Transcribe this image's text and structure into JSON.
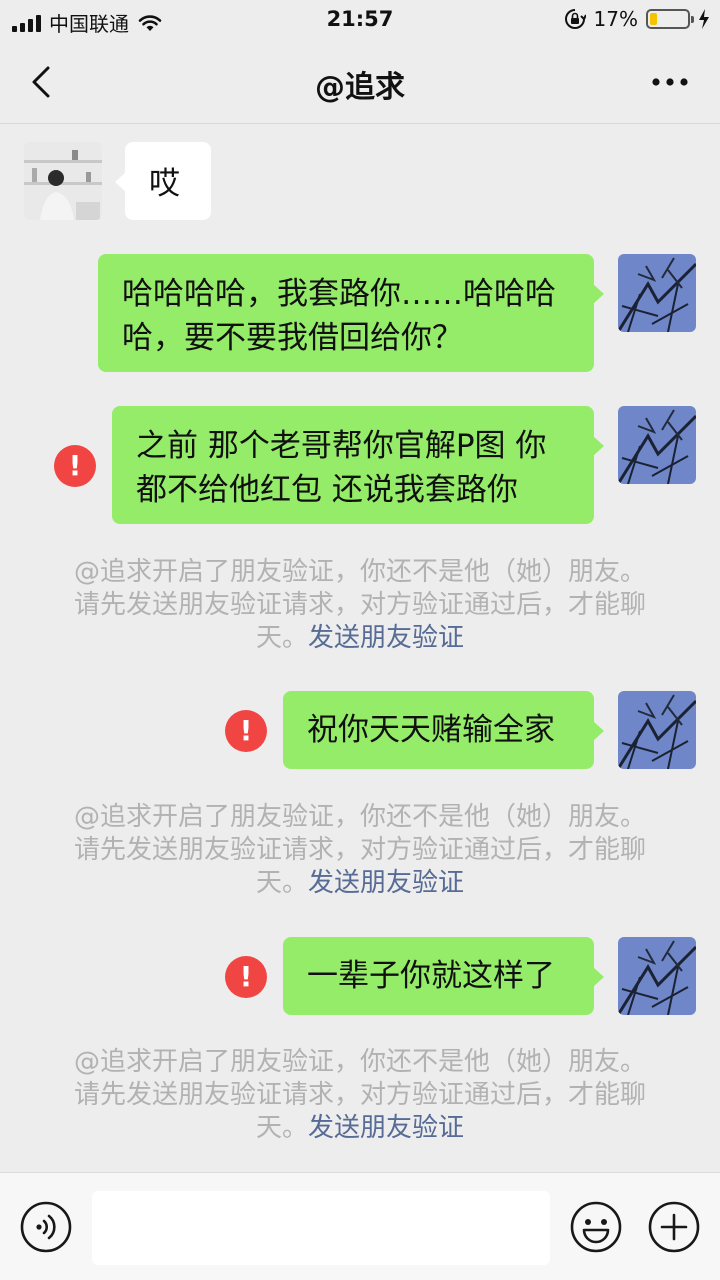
{
  "status_bar": {
    "carrier": "中国联通",
    "time": "21:57",
    "battery_percent": "17%",
    "battery_level": 0.17,
    "signal_bars": 4
  },
  "nav": {
    "title": "@追求"
  },
  "messages": [
    {
      "side": "left",
      "text": "哎"
    },
    {
      "side": "right",
      "line1": "哈哈哈哈，我套路你……哈哈哈",
      "line2": "哈，要不要我借回给你？"
    },
    {
      "side": "right",
      "failed": true,
      "line1": "之前 那个老哥帮你官解P图 你",
      "line2": "都不给他红包 还说我套路你"
    },
    {
      "side": "right",
      "failed": true,
      "text": "祝你天天赌输全家"
    },
    {
      "side": "right",
      "failed": true,
      "text": "一辈子你就这样了"
    }
  ],
  "system_note": {
    "line1": "@追求开启了朋友验证，你还不是他（她）朋友。",
    "line2": "请先发送朋友验证请求，对方验证通过后，才能聊",
    "line3_prefix": "天。",
    "link": "发送朋友验证"
  },
  "error_glyph": "!",
  "colors": {
    "background": "#ededed",
    "bubble_self": "#95ec69",
    "bubble_other": "#ffffff",
    "error": "#f04542",
    "link": "#576b95",
    "system_text": "#b2b2b2"
  },
  "icons": {
    "back": "chevron-left-icon",
    "more": "more-dots-icon",
    "voice": "voice-icon",
    "emoji": "emoji-icon",
    "add": "plus-icon"
  }
}
